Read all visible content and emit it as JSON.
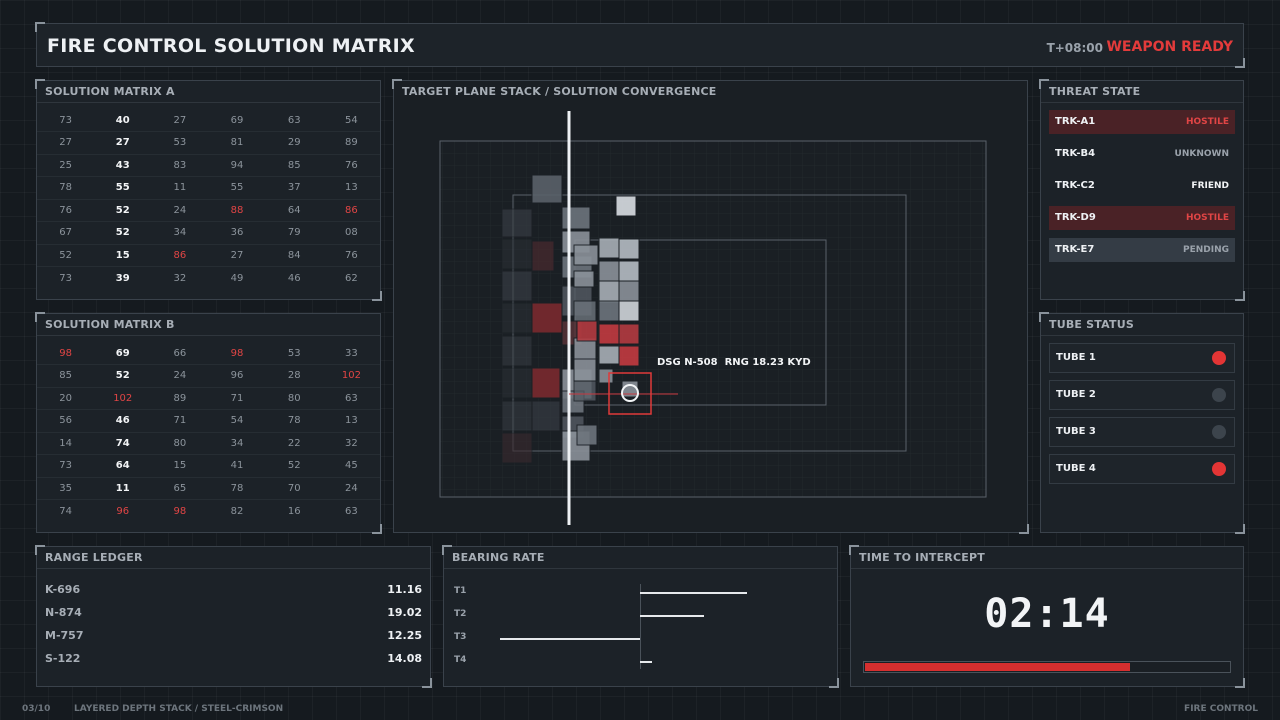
{
  "header": {
    "title": "FIRE CONTROL SOLUTION MATRIX",
    "time": "T+08:00",
    "status": "WEAPON READY",
    "status_color": "#e33b3b"
  },
  "matrix_a": {
    "title": "SOLUTION MATRIX A",
    "rows": [
      [
        [
          "73",
          "n"
        ],
        [
          "40",
          "h"
        ],
        [
          "27",
          "n"
        ],
        [
          "69",
          "n"
        ],
        [
          "63",
          "n"
        ],
        [
          "54",
          "n"
        ]
      ],
      [
        [
          "27",
          "n"
        ],
        [
          "27",
          "h"
        ],
        [
          "53",
          "n"
        ],
        [
          "81",
          "n"
        ],
        [
          "29",
          "n"
        ],
        [
          "89",
          "n"
        ]
      ],
      [
        [
          "25",
          "n"
        ],
        [
          "43",
          "h"
        ],
        [
          "83",
          "n"
        ],
        [
          "94",
          "n"
        ],
        [
          "85",
          "n"
        ],
        [
          "76",
          "n"
        ]
      ],
      [
        [
          "78",
          "n"
        ],
        [
          "55",
          "h"
        ],
        [
          "11",
          "n"
        ],
        [
          "55",
          "n"
        ],
        [
          "37",
          "n"
        ],
        [
          "13",
          "n"
        ]
      ],
      [
        [
          "76",
          "n"
        ],
        [
          "52",
          "h"
        ],
        [
          "24",
          "n"
        ],
        [
          "88",
          "r"
        ],
        [
          "64",
          "n"
        ],
        [
          "86",
          "r"
        ]
      ],
      [
        [
          "67",
          "n"
        ],
        [
          "52",
          "h"
        ],
        [
          "34",
          "n"
        ],
        [
          "36",
          "n"
        ],
        [
          "79",
          "n"
        ],
        [
          "08",
          "n"
        ]
      ],
      [
        [
          "52",
          "n"
        ],
        [
          "15",
          "h"
        ],
        [
          "86",
          "r"
        ],
        [
          "27",
          "n"
        ],
        [
          "84",
          "n"
        ],
        [
          "76",
          "n"
        ]
      ],
      [
        [
          "73",
          "n"
        ],
        [
          "39",
          "h"
        ],
        [
          "32",
          "n"
        ],
        [
          "49",
          "n"
        ],
        [
          "46",
          "n"
        ],
        [
          "62",
          "n"
        ]
      ]
    ]
  },
  "matrix_b": {
    "title": "SOLUTION MATRIX B",
    "rows": [
      [
        [
          "98",
          "r"
        ],
        [
          "69",
          "h"
        ],
        [
          "66",
          "n"
        ],
        [
          "98",
          "r"
        ],
        [
          "53",
          "n"
        ],
        [
          "33",
          "n"
        ]
      ],
      [
        [
          "85",
          "n"
        ],
        [
          "52",
          "h"
        ],
        [
          "24",
          "n"
        ],
        [
          "96",
          "n"
        ],
        [
          "28",
          "n"
        ],
        [
          "102",
          "r"
        ]
      ],
      [
        [
          "20",
          "n"
        ],
        [
          "102",
          "r"
        ],
        [
          "89",
          "n"
        ],
        [
          "71",
          "n"
        ],
        [
          "80",
          "n"
        ],
        [
          "63",
          "n"
        ]
      ],
      [
        [
          "56",
          "n"
        ],
        [
          "46",
          "h"
        ],
        [
          "71",
          "n"
        ],
        [
          "54",
          "n"
        ],
        [
          "78",
          "n"
        ],
        [
          "13",
          "n"
        ]
      ],
      [
        [
          "14",
          "n"
        ],
        [
          "74",
          "h"
        ],
        [
          "80",
          "n"
        ],
        [
          "34",
          "n"
        ],
        [
          "22",
          "n"
        ],
        [
          "32",
          "n"
        ]
      ],
      [
        [
          "73",
          "n"
        ],
        [
          "64",
          "h"
        ],
        [
          "15",
          "n"
        ],
        [
          "41",
          "n"
        ],
        [
          "52",
          "n"
        ],
        [
          "45",
          "n"
        ]
      ],
      [
        [
          "35",
          "n"
        ],
        [
          "11",
          "h"
        ],
        [
          "65",
          "n"
        ],
        [
          "78",
          "n"
        ],
        [
          "70",
          "n"
        ],
        [
          "24",
          "n"
        ]
      ],
      [
        [
          "74",
          "n"
        ],
        [
          "96",
          "r"
        ],
        [
          "98",
          "r"
        ],
        [
          "82",
          "n"
        ],
        [
          "16",
          "n"
        ],
        [
          "63",
          "n"
        ]
      ]
    ]
  },
  "target": {
    "title": "TARGET PLANE STACK / SOLUTION CONVERGENCE",
    "designation": "DSG N-508",
    "range": "RNG 18.23 KYD"
  },
  "threat": {
    "title": "THREAT STATE",
    "tracks": [
      {
        "id": "TRK-A1",
        "state": "HOSTILE",
        "kind": "hostile"
      },
      {
        "id": "TRK-B4",
        "state": "UNKNOWN",
        "kind": "unknown"
      },
      {
        "id": "TRK-C2",
        "state": "FRIEND",
        "kind": "friend"
      },
      {
        "id": "TRK-D9",
        "state": "HOSTILE",
        "kind": "hostile"
      },
      {
        "id": "TRK-E7",
        "state": "PENDING",
        "kind": "pending"
      }
    ]
  },
  "tubes": {
    "title": "TUBE STATUS",
    "items": [
      {
        "label": "TUBE 1",
        "active": true
      },
      {
        "label": "TUBE 2",
        "active": false
      },
      {
        "label": "TUBE 3",
        "active": false
      },
      {
        "label": "TUBE 4",
        "active": true
      }
    ]
  },
  "ledger": {
    "title": "RANGE LEDGER",
    "rows": [
      {
        "key": "K-696",
        "value": "11.16"
      },
      {
        "key": "N-874",
        "value": "19.02"
      },
      {
        "key": "M-757",
        "value": "12.25"
      },
      {
        "key": "S-122",
        "value": "14.08"
      }
    ]
  },
  "bearing": {
    "title": "BEARING RATE",
    "rows": [
      {
        "label": "T1",
        "rate": 0.55
      },
      {
        "label": "T2",
        "rate": 0.33
      },
      {
        "label": "T3",
        "rate": -0.72
      },
      {
        "label": "T4",
        "rate": 0.06
      }
    ]
  },
  "tti": {
    "title": "TIME TO INTERCEPT",
    "time": "02:14",
    "progress": 0.73
  },
  "footer": {
    "page": "03/10",
    "caption": "LAYERED DEPTH STACK / STEEL-CRIMSON",
    "system": "FIRE CONTROL"
  }
}
